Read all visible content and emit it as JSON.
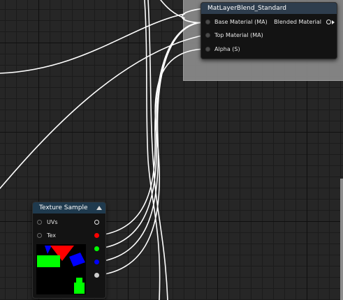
{
  "colors": {
    "canvas": "#262626",
    "comment_box": "#8a8a8a",
    "blend_header": "#2e3d4d",
    "texture_header": "#1f3a4e",
    "wire": "#ffffff",
    "pin_red": "#ff0000",
    "pin_green": "#00ff00",
    "pin_blue": "#0000ff",
    "pin_alpha": "#cccccc"
  },
  "blend_node": {
    "title": "MatLayerBlend_Standard",
    "inputs": [
      "Base Material (MA)",
      "Top Material (MA)",
      "Alpha (S)"
    ],
    "output": "Blended Material"
  },
  "texture_node": {
    "title": "Texture Sample",
    "collapse_icon": "triangle-up-icon",
    "inputs": [
      "UVs",
      "Tex"
    ],
    "outputs": [
      "rgb",
      "r",
      "g",
      "b",
      "a"
    ]
  }
}
